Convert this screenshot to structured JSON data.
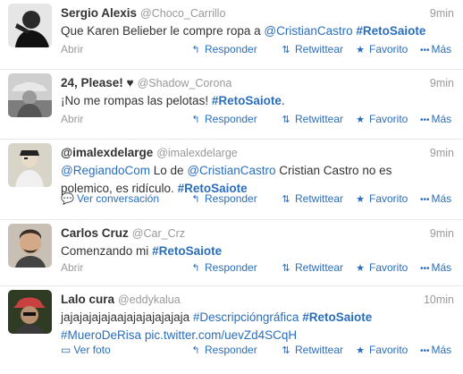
{
  "tweets": [
    {
      "fullname": "Sergio Alexis",
      "handle": "@Choco_Carrillo",
      "time": "9min",
      "segments": [
        {
          "t": "Que Karen Belieber le compre ropa a "
        },
        {
          "t": "@CristianCastro",
          "link": true
        },
        {
          "t": " "
        },
        {
          "t": "#RetoSaiote",
          "hashtag": true
        }
      ],
      "expand": "Abrir",
      "expand_icon": ""
    },
    {
      "fullname": "24, Please! ♥",
      "handle": "@Shadow_Corona",
      "time": "9min",
      "segments": [
        {
          "t": "¡No me rompas las pelotas! "
        },
        {
          "t": "#RetoSaiote",
          "hashtag": true
        },
        {
          "t": "."
        }
      ],
      "expand": "Abrir",
      "expand_icon": ""
    },
    {
      "fullname": "@imalexdelarge",
      "handle": "@imalexdelarge",
      "time": "9min",
      "segments": [
        {
          "t": "@RegiandoCom",
          "link": true
        },
        {
          "t": " Lo de "
        },
        {
          "t": "@CristianCastro",
          "link": true
        },
        {
          "t": " Cristian Castro no es polemico, es ridículo. "
        },
        {
          "t": "#RetoSaiote",
          "hashtag": true
        }
      ],
      "expand": "Ver conversación",
      "expand_icon": "speech-bubble-icon"
    },
    {
      "fullname": "Carlos Cruz",
      "handle": "@Car_Crz",
      "time": "9min",
      "segments": [
        {
          "t": "Comenzando mi "
        },
        {
          "t": "#RetoSaiote",
          "hashtag": true
        }
      ],
      "expand": "Abrir",
      "expand_icon": ""
    },
    {
      "fullname": "Lalo cura",
      "handle": "@eddykalua",
      "time": "10min",
      "segments": [
        {
          "t": "jajajajajajaajajajajajajaja "
        },
        {
          "t": "#Descripcióngráfica",
          "link": true
        },
        {
          "t": " "
        },
        {
          "t": "#RetoSaiote",
          "hashtag": true
        },
        {
          "t": " "
        },
        {
          "t": "#MueroDeRisa",
          "link": true
        },
        {
          "t": " "
        },
        {
          "t": "pic.twitter.com/uevZd4SCqH",
          "link": true
        }
      ],
      "expand": "Ver foto",
      "expand_icon": "photo-icon"
    }
  ],
  "actions": {
    "reply": "Responder",
    "retweet": "Retwittear",
    "favorite": "Favorito",
    "more": "Más"
  },
  "colors": {
    "link": "#2a6ebb",
    "muted": "#999999",
    "text": "#333333",
    "divider": "#e8e8e8"
  }
}
